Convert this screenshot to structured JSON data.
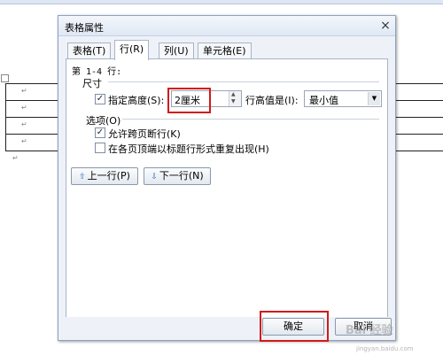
{
  "background": {
    "paragraph_mark": "↵"
  },
  "dialog": {
    "title": "表格属性",
    "tabs": [
      {
        "label": "表格(T)"
      },
      {
        "label": "行(R)"
      },
      {
        "label": "列(U)"
      },
      {
        "label": "单元格(E)"
      }
    ],
    "row_range": "第 1-4 行:",
    "size_section": "尺寸",
    "specify_height_label": "指定高度(S):",
    "specify_height_checked": true,
    "height_value": "2厘米",
    "row_height_is_label": "行高值是(I):",
    "row_height_mode": "最小值",
    "options_section": "选项(O)",
    "allow_break_label": "允许跨页断行(K)",
    "allow_break_checked": true,
    "repeat_header_label": "在各页顶端以标题行形式重复出现(H)",
    "repeat_header_checked": false,
    "prev_row_label": "上一行(P)",
    "next_row_label": "下一行(N)",
    "ok_label": "确定",
    "cancel_label": "取消"
  },
  "watermark": {
    "brand": "Bai 经验",
    "url": "jingyan.baidu.com"
  },
  "colors": {
    "highlight_box": "#d11a1a",
    "dialog_bg": "#eef2f8",
    "arrow_icon": "#2f69c9"
  }
}
